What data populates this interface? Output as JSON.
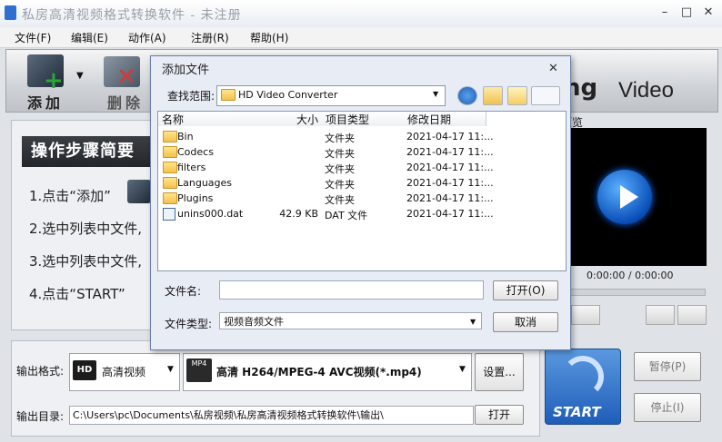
{
  "window": {
    "title": "私房高清视频格式转换软件 - 未注册"
  },
  "menu": [
    "文件(F)",
    "编辑(E)",
    "动作(A)",
    "注册(R)",
    "帮助(H)"
  ],
  "toolbar": {
    "add_label": "添加",
    "delete_label": "删除",
    "brand_bold": "ng",
    "brand": "Video"
  },
  "guide": {
    "title": "操作步骤简要",
    "steps": [
      "1.点击“添加”",
      "2.选中列表中文件,",
      "3.选中列表中文件,",
      "4.点击“START”"
    ]
  },
  "preview": {
    "label": "预览",
    "time": "0:00:00 / 0:00:00"
  },
  "bottom": {
    "format_label": "输出格式:",
    "format_category": "高清视频",
    "format_value": "高清 H264/MPEG-4 AVC视频(*.mp4)",
    "settings_button": "设置...",
    "dir_label": "输出目录:",
    "dir_value": "C:\\Users\\pc\\Documents\\私房视频\\私房高清视频格式转换软件\\输出\\",
    "open_button": "打开",
    "start_button": "START",
    "pause_button": "暂停(P)",
    "stop_button": "停止(I)"
  },
  "dialog": {
    "title": "添加文件",
    "lookin_label": "查找范围:",
    "lookin_value": "HD Video Converter",
    "columns": [
      "名称",
      "大小",
      "项目类型",
      "修改日期"
    ],
    "files": [
      {
        "name": "Bin",
        "size": "",
        "type": "文件夹",
        "date": "2021-04-17 11:...",
        "icon": "folder"
      },
      {
        "name": "Codecs",
        "size": "",
        "type": "文件夹",
        "date": "2021-04-17 11:...",
        "icon": "folder"
      },
      {
        "name": "filters",
        "size": "",
        "type": "文件夹",
        "date": "2021-04-17 11:...",
        "icon": "folder"
      },
      {
        "name": "Languages",
        "size": "",
        "type": "文件夹",
        "date": "2021-04-17 11:...",
        "icon": "folder"
      },
      {
        "name": "Plugins",
        "size": "",
        "type": "文件夹",
        "date": "2021-04-17 11:...",
        "icon": "folder"
      },
      {
        "name": "unins000.dat",
        "size": "42.9 KB",
        "type": "DAT 文件",
        "date": "2021-04-17 11:...",
        "icon": "file"
      }
    ],
    "filename_label": "文件名:",
    "filename_value": "",
    "filetype_label": "文件类型:",
    "filetype_value": "视频音频文件",
    "open_button": "打开(O)",
    "cancel_button": "取消"
  }
}
